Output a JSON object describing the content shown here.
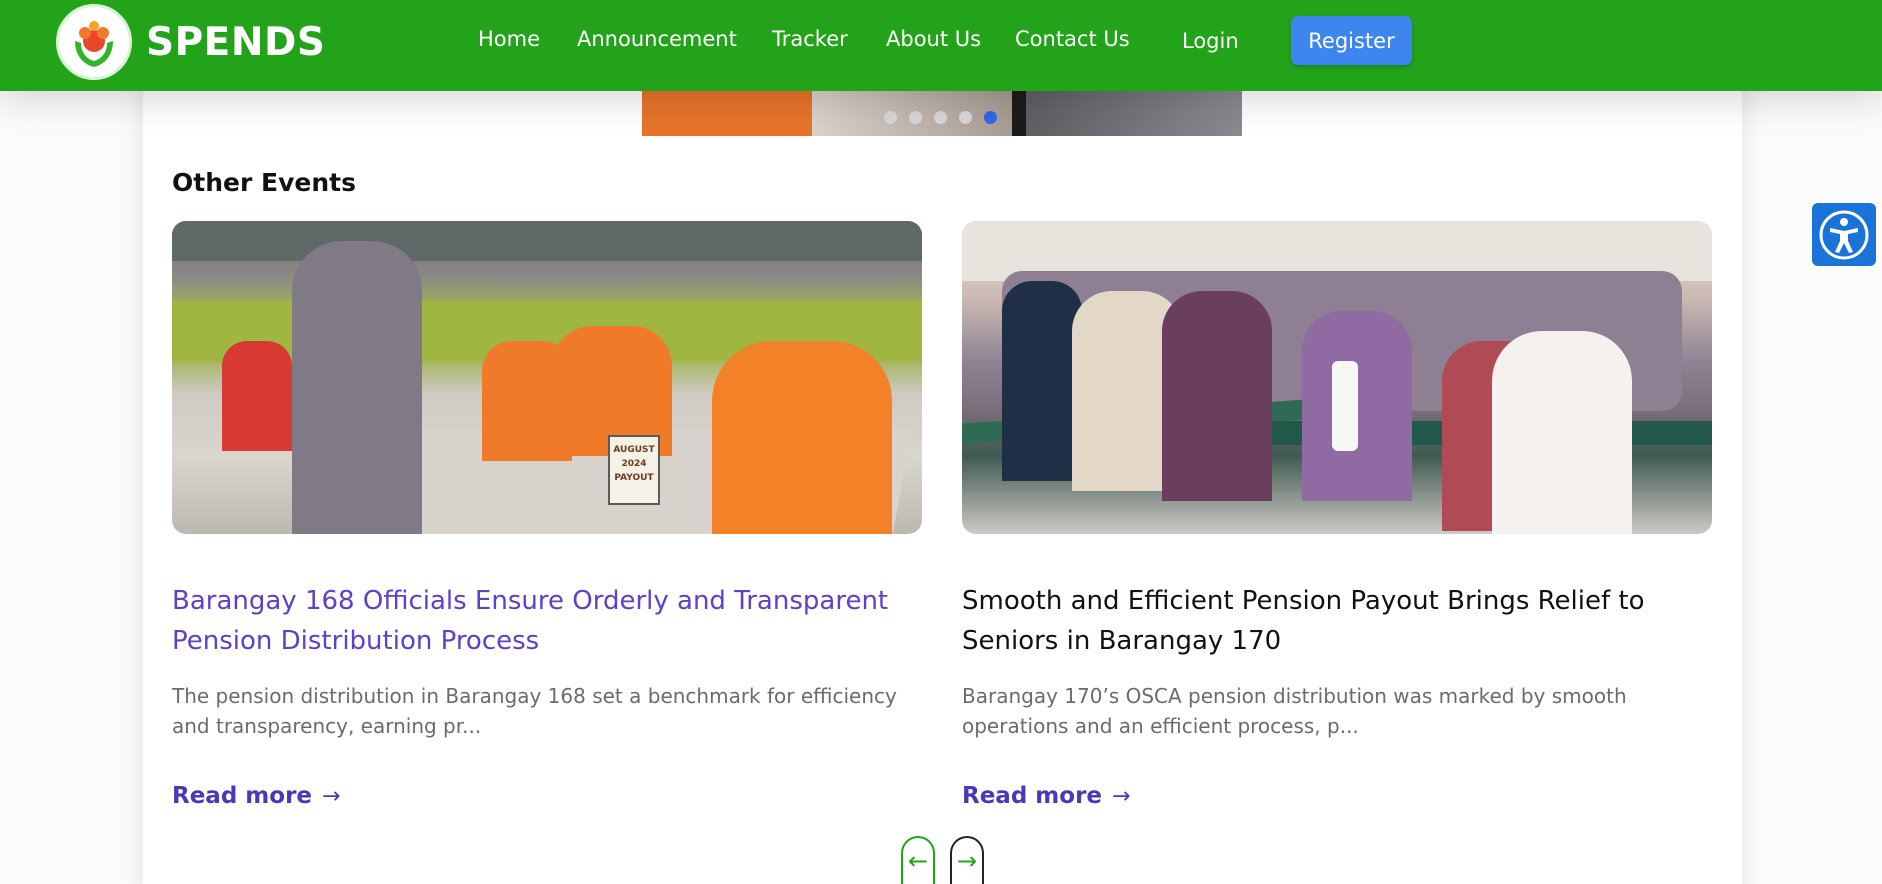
{
  "brand": {
    "name": "SPENDS"
  },
  "nav": {
    "links": [
      "Home",
      "Announcement",
      "Tracker",
      "About Us",
      "Contact Us",
      "Login"
    ],
    "register": "Register"
  },
  "slider": {
    "dots": 5,
    "active_dot": 5
  },
  "section": {
    "title": "Other Events"
  },
  "events": [
    {
      "title": "Barangay 168 Officials Ensure Orderly and Transparent Pension Distribution Process",
      "description": "The pension distribution in Barangay 168 set a benchmark for efficiency and transparency, earning pr...",
      "read_more": "Read more",
      "sign_text": "AUGUST 2024 PAYOUT"
    },
    {
      "title": "Smooth and Efficient Pension Payout Brings Relief to Seniors in Barangay 170",
      "description": "Barangay 170’s OSCA pension distribution was marked by smooth operations and an efficient process, p...",
      "read_more": "Read more"
    }
  ],
  "pager": {
    "prev": "←",
    "next": "→"
  },
  "colors": {
    "nav_bg": "#22a31a",
    "register_bg": "#3d86f0",
    "link_title": "#5a42c9",
    "read_more": "#4a38b8",
    "active_dot": "#3266e6",
    "a11y_bg": "#1a73d9"
  },
  "icons": {
    "logo": "spends-logo-icon",
    "read_more_arrow": "arrow-right-icon",
    "prev": "arrow-left-icon",
    "next": "arrow-right-icon",
    "accessibility": "accessibility-icon"
  }
}
